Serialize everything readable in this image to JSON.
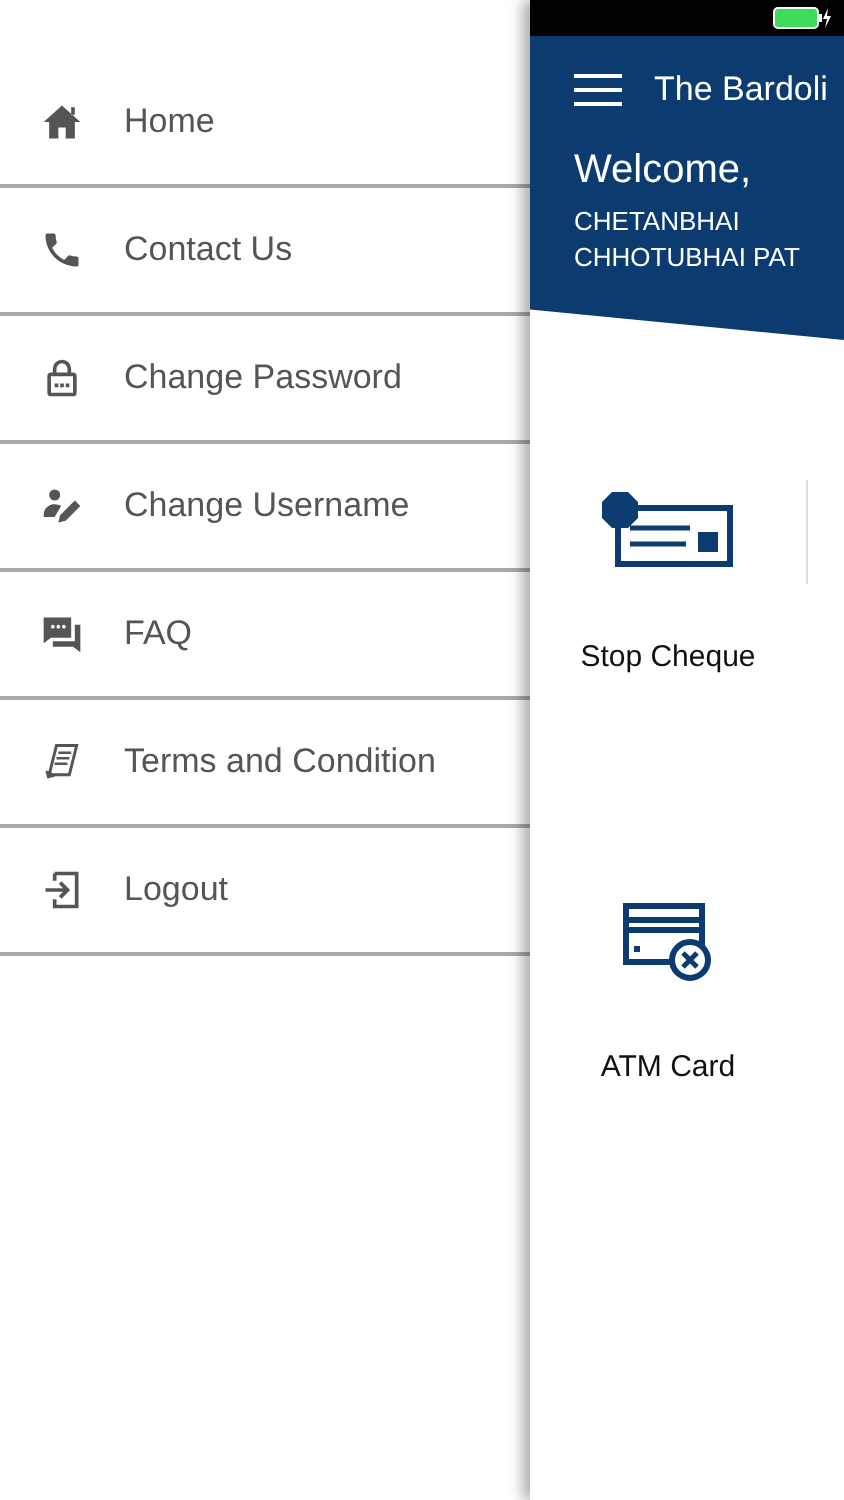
{
  "drawer": {
    "items": [
      {
        "label": "Home",
        "kind": "home"
      },
      {
        "label": "Contact Us",
        "kind": "phone"
      },
      {
        "label": "Change Password",
        "kind": "lock"
      },
      {
        "label": "Change Username",
        "kind": "user-edit"
      },
      {
        "label": "FAQ",
        "kind": "chat"
      },
      {
        "label": "Terms and Condition",
        "kind": "document"
      },
      {
        "label": "Logout",
        "kind": "logout"
      }
    ]
  },
  "app_bar": {
    "title": "The Bardoli"
  },
  "welcome": {
    "greeting": "Welcome,",
    "name_lines": [
      "CHETANBHAI",
      "CHHOTUBHAI PAT"
    ]
  },
  "tiles": [
    {
      "label": "Stop Cheque",
      "kind": "stop-cheque"
    },
    {
      "label": "ATM Card",
      "kind": "atm-card"
    }
  ]
}
